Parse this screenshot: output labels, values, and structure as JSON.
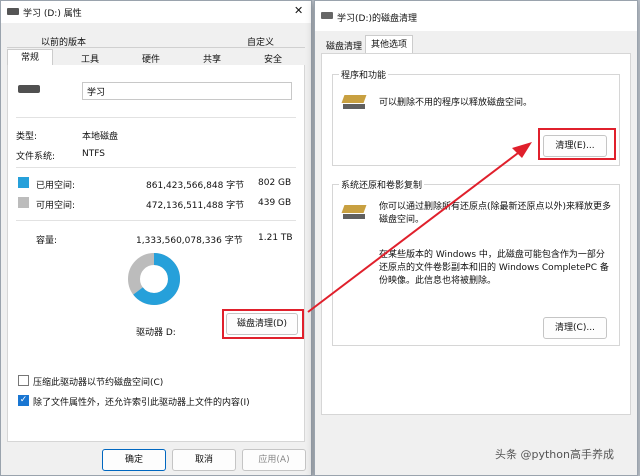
{
  "properties_window": {
    "title": "学习 (D:) 属性",
    "tabs_row1": [
      "以前的版本",
      "自定义"
    ],
    "tabs_row2": [
      "常规",
      "工具",
      "硬件",
      "共享",
      "安全"
    ],
    "active_tab": "常规",
    "drive_name": "学习",
    "type_label": "类型:",
    "type_value": "本地磁盘",
    "fs_label": "文件系统:",
    "fs_value": "NTFS",
    "used_label": "已用空间:",
    "used_bytes": "861,423,566,848 字节",
    "used_size": "802 GB",
    "free_label": "可用空间:",
    "free_bytes": "472,136,511,488 字节",
    "free_size": "439 GB",
    "capacity_label": "容量:",
    "capacity_bytes": "1,333,560,078,336 字节",
    "capacity_size": "1.21 TB",
    "drive_label": "驱动器 D:",
    "cleanup_button": "磁盘清理(D)",
    "compress_checkbox": "压缩此驱动器以节约磁盘空间(C)",
    "index_checkbox": "除了文件属性外，还允许索引此驱动器上文件的内容(I)",
    "ok_button": "确定",
    "cancel_button": "取消",
    "apply_button": "应用(A)",
    "used_color": "#26a0da",
    "free_color": "#bcbcbc",
    "used_fraction": 0.646
  },
  "cleanup_window": {
    "title": "学习(D:)的磁盘清理",
    "tabs": [
      "磁盘清理",
      "其他选项"
    ],
    "active_tab": "其他选项",
    "group1_title": "程序和功能",
    "group1_text": "可以删除不用的程序以释放磁盘空间。",
    "group1_button": "清理(E)...",
    "group2_title": "系统还原和卷影复制",
    "group2_text1": "你可以通过删除所有还原点(除最新还原点以外)来释放更多磁盘空间。",
    "group2_text2": "在某些版本的 Windows 中，此磁盘可能包含作为一部分还原点的文件卷影副本和旧的 Windows CompletePC 备份映像。此信息也将被删除。",
    "group2_button": "清理(C)..."
  },
  "watermark": "头条 @python高手养成"
}
